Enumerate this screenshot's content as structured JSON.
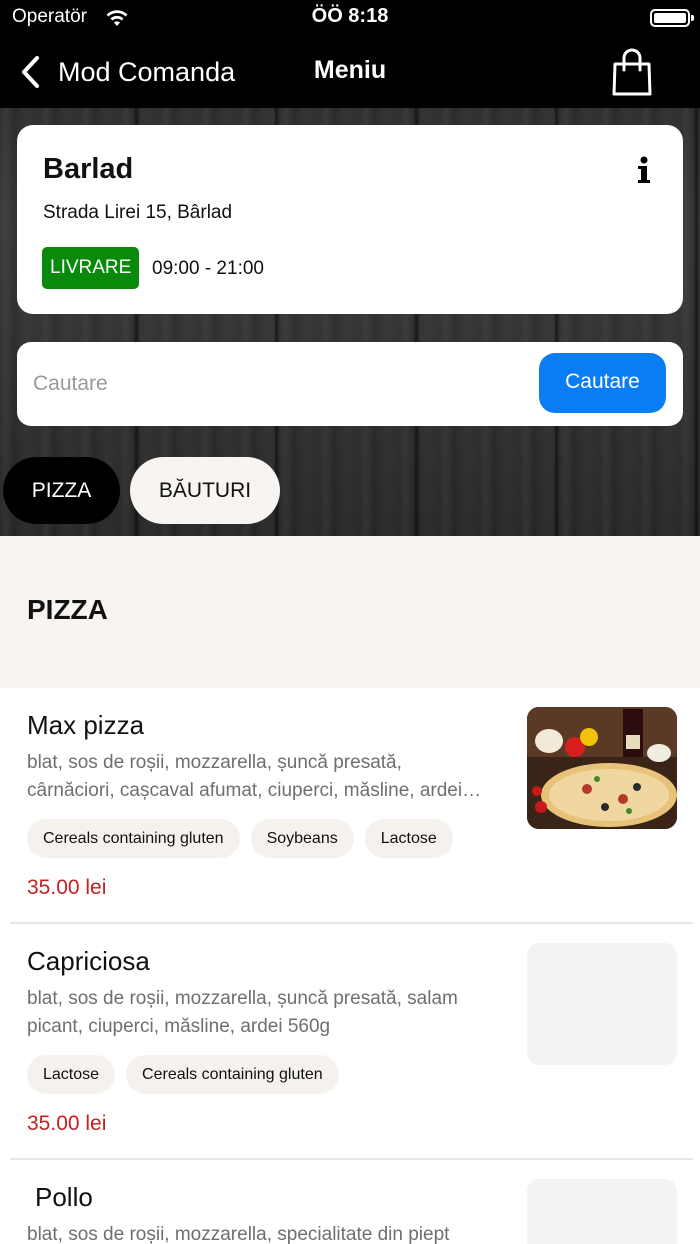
{
  "statusbar": {
    "carrier": "Operatör",
    "time": "ÖÖ 8:18"
  },
  "navbar": {
    "back_label": "Mod Comanda",
    "title": "Meniu"
  },
  "store": {
    "name": "Barlad",
    "address": "Strada Lirei 15, Bârlad",
    "badge": "LIVRARE",
    "badge_color": "#0a8a0a",
    "hours": "09:00 - 21:00"
  },
  "search": {
    "placeholder": "Cautare",
    "value": "",
    "button_label": "Cautare",
    "button_color": "#0a7cf4"
  },
  "categories": [
    {
      "label": "PIZZA",
      "selected": true
    },
    {
      "label": "BĂUTURI",
      "selected": false
    }
  ],
  "section": {
    "title": "PIZZA"
  },
  "items": [
    {
      "title": "Max pizza",
      "desc_line1": "blat, sos de roșii, mozzarella, șuncă presată,",
      "desc_line2": "cârnăciori, cașcaval afumat, ciuperci, măsline, ardei…",
      "tags": [
        "Cereals containing gluten",
        "Soybeans",
        "Lactose"
      ],
      "price": "35.00 lei",
      "has_image": true
    },
    {
      "title": "Capriciosa",
      "desc_line1": "blat, sos de roșii, mozzarella, șuncă presată, salam",
      "desc_line2": "picant, ciuperci, măsline, ardei 560g",
      "tags": [
        "Lactose",
        "Cereals containing gluten"
      ],
      "price": "35.00 lei",
      "has_image": false
    },
    {
      "title": "Pollo",
      "desc_line1": "blat, sos de roșii, mozzarella, specialitate din piept",
      "has_image": false
    }
  ],
  "colors": {
    "price": "#c62020",
    "accent_blue": "#0a7cf4",
    "header_bg": "#000000",
    "section_bg": "#f7f4f1"
  }
}
